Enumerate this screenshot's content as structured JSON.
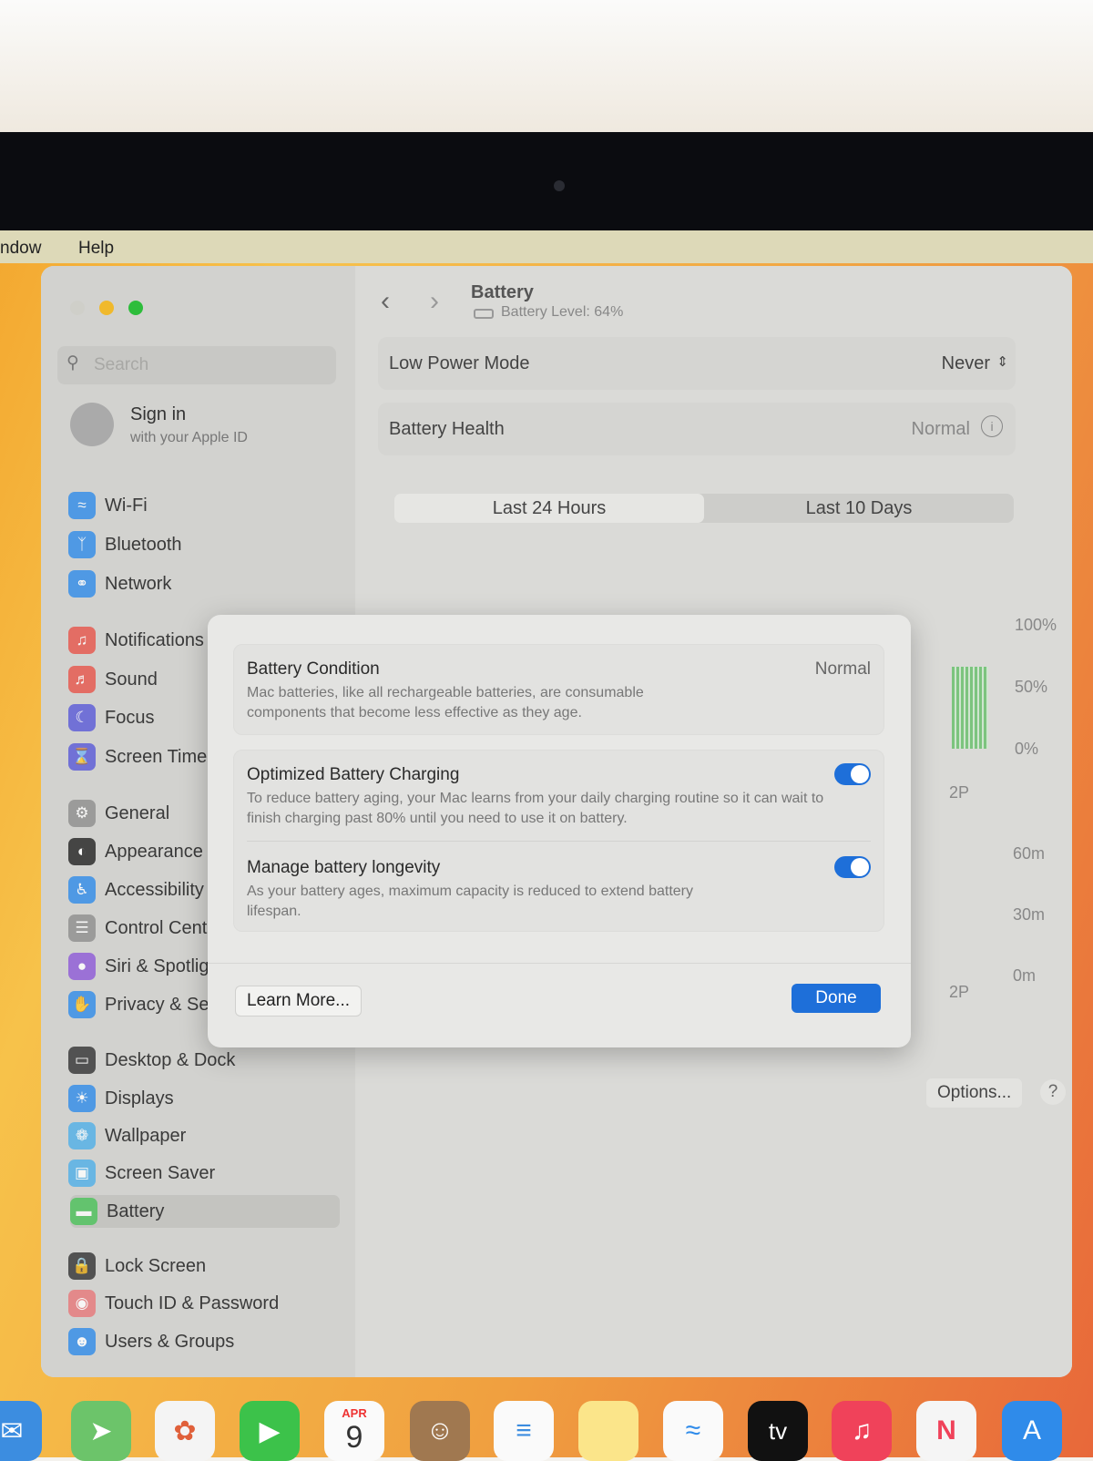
{
  "menubar": {
    "items": [
      "ndow",
      "Help"
    ]
  },
  "sidebar": {
    "search_placeholder": "Search",
    "account": {
      "title": "Sign in",
      "subtitle": "with your Apple ID"
    },
    "items": [
      {
        "label": "Wi-Fi",
        "icon": "wifi-icon",
        "color": "#2f8bea"
      },
      {
        "label": "Bluetooth",
        "icon": "bluetooth-icon",
        "color": "#2f8bea"
      },
      {
        "label": "Network",
        "icon": "globe-icon",
        "color": "#2f8bea"
      },
      {
        "label": "Notifications",
        "icon": "bell-icon",
        "color": "#e8554a"
      },
      {
        "label": "Sound",
        "icon": "speaker-icon",
        "color": "#e8554a"
      },
      {
        "label": "Focus",
        "icon": "moon-icon",
        "color": "#5a5ad8"
      },
      {
        "label": "Screen Time",
        "icon": "hourglass-icon",
        "color": "#5a5ad8"
      },
      {
        "label": "General",
        "icon": "gear-icon",
        "color": "#8e8e8e"
      },
      {
        "label": "Appearance",
        "icon": "appearance-icon",
        "color": "#222"
      },
      {
        "label": "Accessibility",
        "icon": "accessibility-icon",
        "color": "#2f8bea"
      },
      {
        "label": "Control Centre",
        "icon": "control-centre-icon",
        "color": "#8e8e8e"
      },
      {
        "label": "Siri & Spotlight",
        "icon": "siri-icon",
        "color": "#8e5ad8"
      },
      {
        "label": "Privacy & Security",
        "icon": "hand-icon",
        "color": "#2f8bea"
      },
      {
        "label": "Desktop & Dock",
        "icon": "dock-icon",
        "color": "#333"
      },
      {
        "label": "Displays",
        "icon": "sun-icon",
        "color": "#2f8bea"
      },
      {
        "label": "Wallpaper",
        "icon": "flower-icon",
        "color": "#4fb0e8"
      },
      {
        "label": "Screen Saver",
        "icon": "screensaver-icon",
        "color": "#4fb0e8"
      },
      {
        "label": "Battery",
        "icon": "battery-icon",
        "color": "#4cc35a"
      },
      {
        "label": "Lock Screen",
        "icon": "lock-icon",
        "color": "#333"
      },
      {
        "label": "Touch ID & Password",
        "icon": "fingerprint-icon",
        "color": "#e8787a"
      },
      {
        "label": "Users & Groups",
        "icon": "users-icon",
        "color": "#2f8bea"
      }
    ]
  },
  "main": {
    "title": "Battery",
    "battery_level": "Battery Level: 64%",
    "low_power_label": "Low Power Mode",
    "low_power_value": "Never",
    "health_label": "Battery Health",
    "health_value": "Normal",
    "tabs": [
      "Last 24 Hours",
      "Last 10 Days"
    ],
    "chart_labels": {
      "level": [
        "100%",
        "50%",
        "0%"
      ],
      "usage": [
        "60m",
        "30m",
        "0m"
      ],
      "time": "2P"
    },
    "options_label": "Options...",
    "help_label": "?"
  },
  "dialog": {
    "condition_title": "Battery Condition",
    "condition_value": "Normal",
    "condition_desc": "Mac batteries, like all rechargeable batteries, are consumable components that become less effective as they age.",
    "optimized_title": "Optimized Battery Charging",
    "optimized_desc": "To reduce battery aging, your Mac learns from your daily charging routine so it can wait to finish charging past 80% until you need to use it on battery.",
    "optimized_on": true,
    "longevity_title": "Manage battery longevity",
    "longevity_desc": "As your battery ages, maximum capacity is reduced to extend battery lifespan.",
    "longevity_on": true,
    "learn_more": "Learn More...",
    "done": "Done",
    "accent": "#1e6fd9"
  },
  "dock": {
    "calendar_month": "APR",
    "calendar_day": "9",
    "tv_label": "tv"
  }
}
